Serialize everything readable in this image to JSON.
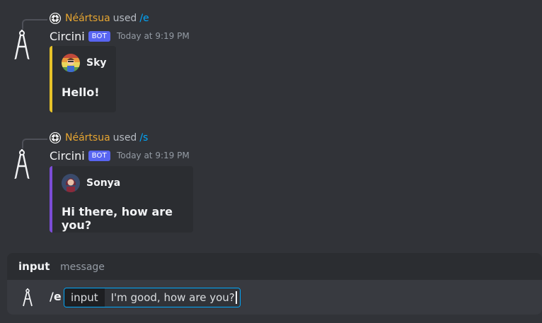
{
  "messages": [
    {
      "ref_user": "Néártsua",
      "ref_used": "used",
      "ref_command": "/e",
      "bot_name": "Circini",
      "bot_badge": "BOT",
      "time": "Today at 9:19 PM",
      "embed_author": "Sky",
      "embed_text": "Hello!",
      "embed_accent": "#e6c229"
    },
    {
      "ref_user": "Néártsua",
      "ref_used": "used",
      "ref_command": "/s",
      "bot_name": "Circini",
      "bot_badge": "BOT",
      "time": "Today at 9:19 PM",
      "embed_author": "Sonya",
      "embed_text": "Hi there, how are you?",
      "embed_accent": "#7c4dd8"
    }
  ],
  "options": {
    "name": "input",
    "description": "message"
  },
  "composer": {
    "command": "/e",
    "option_label": "input",
    "value": "I'm good, how are you?"
  },
  "colors": {
    "background": "#313338",
    "username": "#e6a531",
    "command": "#00a8fc",
    "bot_badge": "#5865f2"
  }
}
